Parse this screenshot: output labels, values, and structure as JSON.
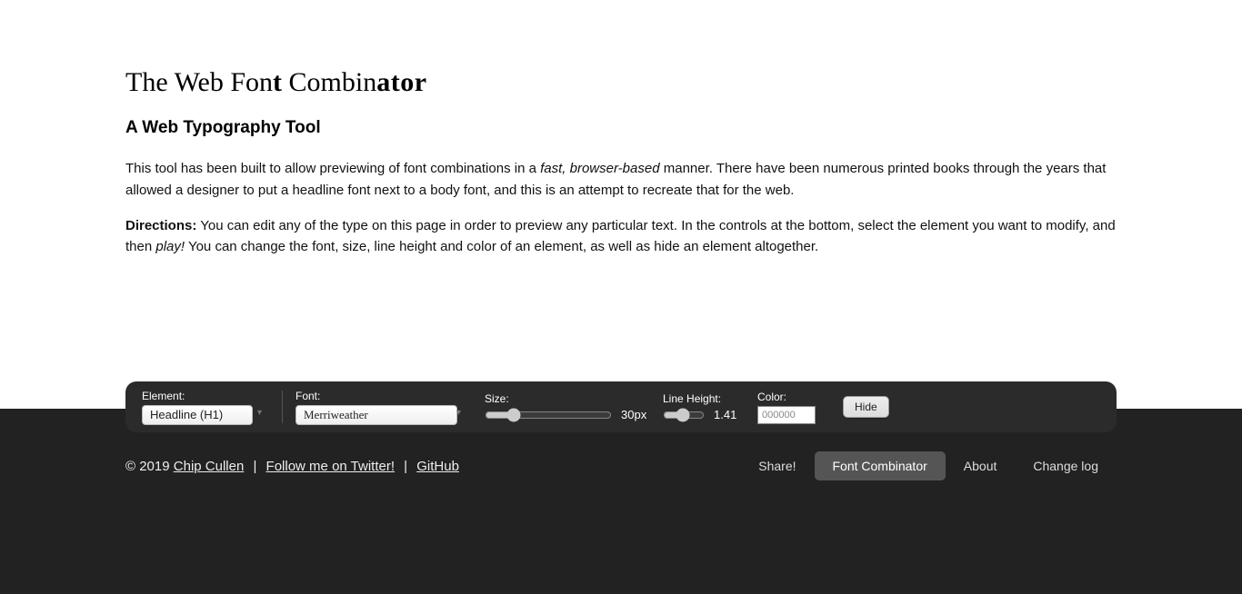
{
  "heading": {
    "pre": "The Web Fon",
    "mid_bold": "t",
    "mid2": " Combin",
    "tail_bold": "ator"
  },
  "subheading": "A Web Typography Tool",
  "para1": {
    "lead": "This tool has been built to allow previewing of font combinations in a ",
    "em": "fast, browser-based",
    "rest": " manner. There have been numerous printed books through the years that allowed a designer to put a headline font next to a body font, and this is an attempt to recreate that for the web."
  },
  "para2": {
    "strong": "Directions:",
    "mid": " You can edit any of the type on this page in order to preview any particular text. In the controls at the bottom, select the element you want to modify, and then ",
    "em": "play!",
    "rest": " You can change the font, size, line height and color of an element, as well as hide an element altogether."
  },
  "controls": {
    "element_label": "Element:",
    "element_value": "Headline (H1)",
    "font_label": "Font:",
    "font_value": "Merriweather",
    "size_label": "Size:",
    "size_value": "30px",
    "lh_label": "Line Height:",
    "lh_value": "1.41",
    "color_label": "Color:",
    "color_value": "000000",
    "hide_label": "Hide"
  },
  "footer": {
    "copyright": "© 2019 ",
    "author": "Chip Cullen",
    "sep": " | ",
    "twitter": "Follow me on Twitter!",
    "github": "GitHub"
  },
  "nav": {
    "share": "Share!",
    "app": "Font Combinator",
    "about": "About",
    "changelog": "Change log"
  }
}
